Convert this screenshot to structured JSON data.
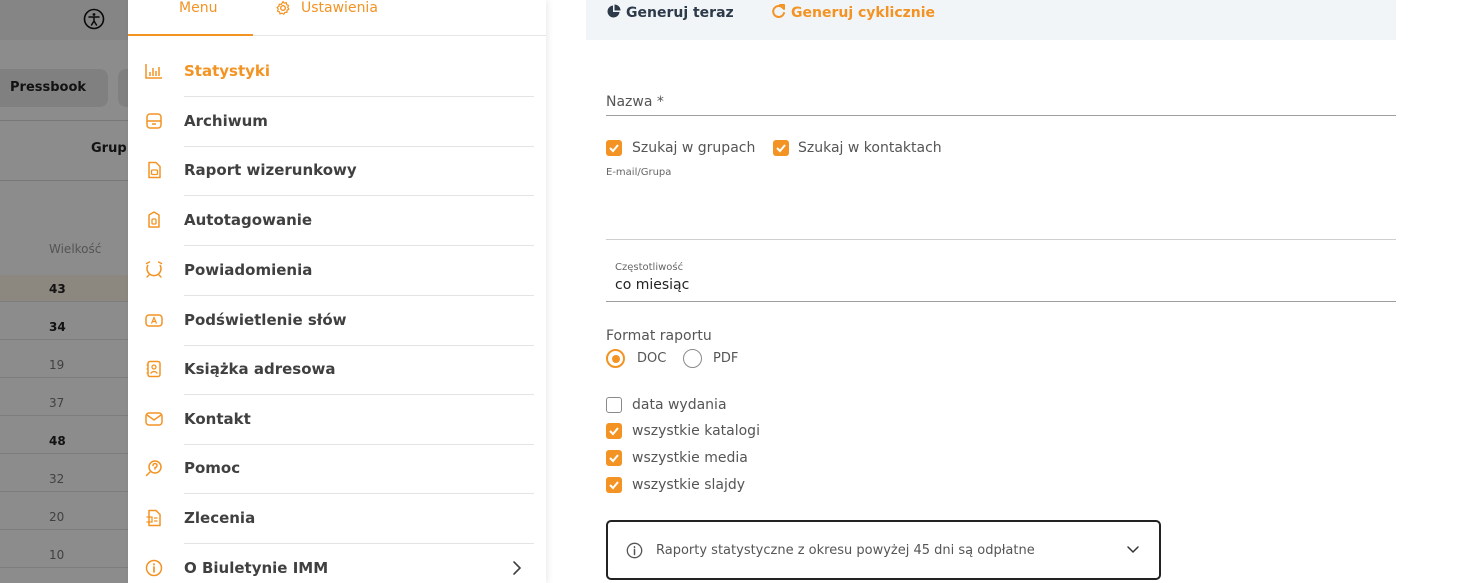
{
  "background": {
    "tab_pressbook": "Pressbook",
    "column_group": "Grup",
    "column_size": "Wielkość",
    "sizes": [
      "43",
      "34",
      "19",
      "37",
      "48",
      "32",
      "20",
      "10"
    ]
  },
  "drawer": {
    "tabs": {
      "menu": "Menu",
      "settings": "Ustawienia"
    },
    "items": [
      {
        "label": "Statystyki",
        "icon": "bar-chart-icon",
        "active": true
      },
      {
        "label": "Archiwum",
        "icon": "archive-icon"
      },
      {
        "label": "Raport wizerunkowy",
        "icon": "report-icon"
      },
      {
        "label": "Autotagowanie",
        "icon": "tag-icon"
      },
      {
        "label": "Powiadomienia",
        "icon": "bell-icon"
      },
      {
        "label": "Podświetlenie słów",
        "icon": "highlight-icon"
      },
      {
        "label": "Książka adresowa",
        "icon": "address-book-icon"
      },
      {
        "label": "Kontakt",
        "icon": "mail-icon"
      },
      {
        "label": "Pomoc",
        "icon": "help-icon"
      },
      {
        "label": "Zlecenia",
        "icon": "orders-icon"
      },
      {
        "label": "O Biuletynie IMM",
        "icon": "info-icon"
      }
    ]
  },
  "toolbar": {
    "generate_now": "Generuj teraz",
    "generate_cyclic": "Generuj cyklicznie"
  },
  "form": {
    "name_label": "Nazwa *",
    "search_groups": "Szukaj w grupach",
    "search_contacts": "Szukaj w kontaktach",
    "email_group_label": "E-mail/Grupa",
    "frequency_label": "Częstotliwość",
    "frequency_value": "co miesiąc",
    "format_label": "Format raportu",
    "format_doc": "DOC",
    "format_pdf": "PDF",
    "options": [
      {
        "label": "data wydania",
        "checked": false
      },
      {
        "label": "wszystkie katalogi",
        "checked": true
      },
      {
        "label": "wszystkie media",
        "checked": true
      },
      {
        "label": "wszystkie slajdy",
        "checked": true
      }
    ],
    "info_text": "Raporty statystyczne z okresu powyżej 45 dni są odpłatne"
  },
  "colors": {
    "accent": "#f39323",
    "text": "#404040",
    "dark": "#2d3a4a"
  }
}
